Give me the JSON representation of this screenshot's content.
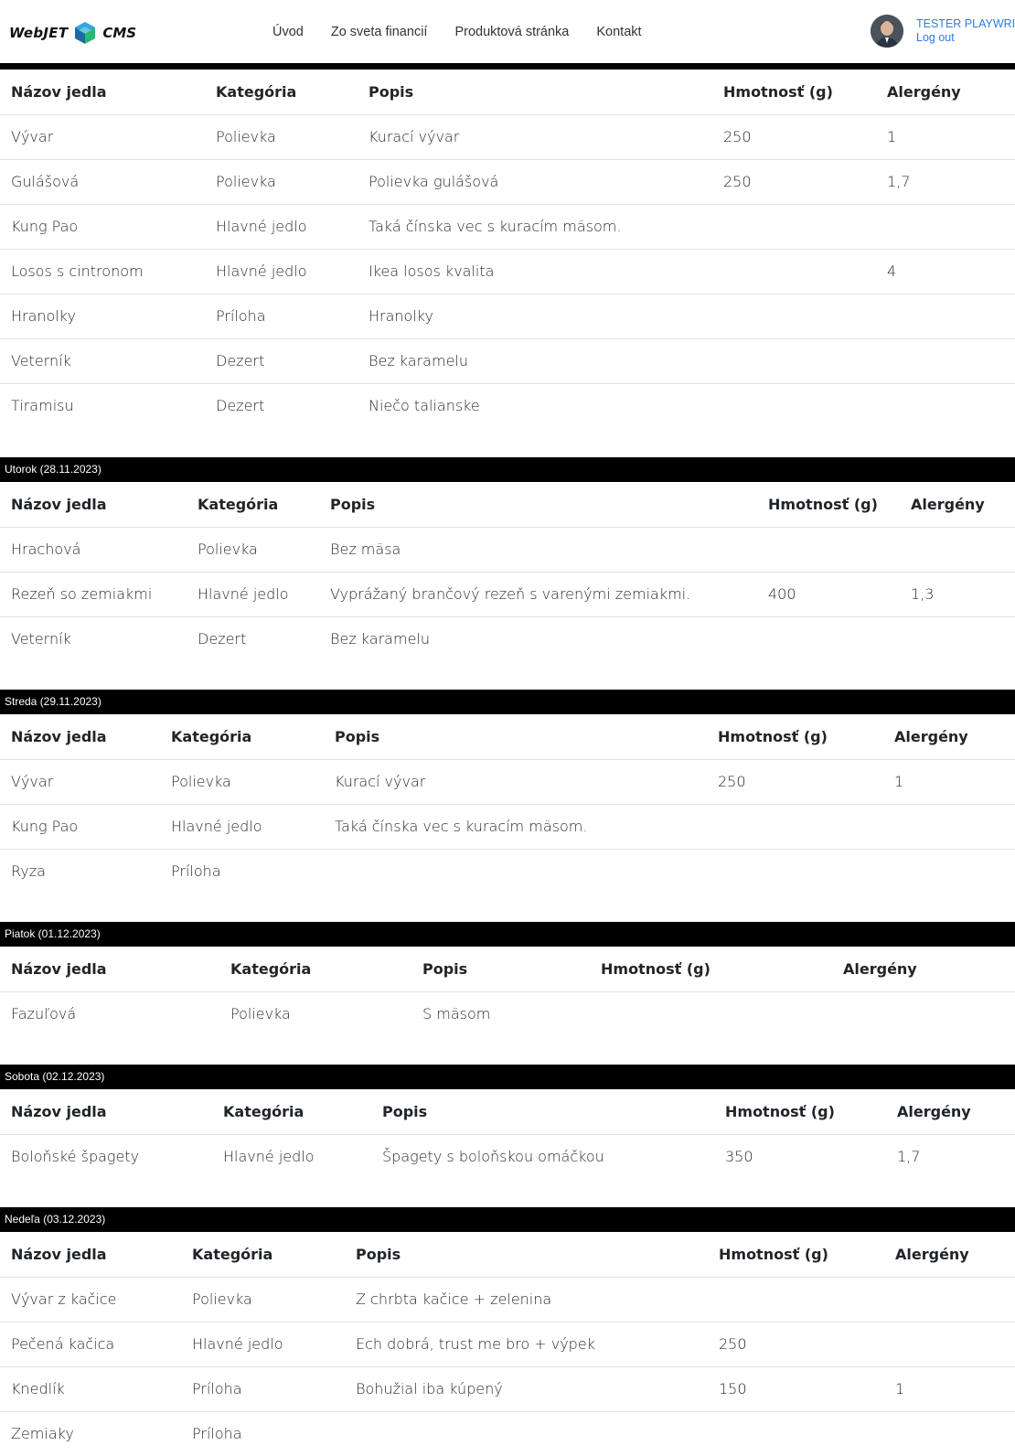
{
  "header": {
    "logo_text_left": "WebJET",
    "logo_text_right": "CMS",
    "nav": [
      "Úvod",
      "Zo sveta financií",
      "Produktová stránka",
      "Kontakt"
    ],
    "user_name": "TESTER PLAYWRIGHT",
    "logout_label": "Log out"
  },
  "columns": [
    "Názov jedla",
    "Kategória",
    "Popis",
    "Hmotnosť (g)",
    "Alergény"
  ],
  "days": [
    {
      "label": "",
      "rows": [
        [
          "Vývar",
          "Polievka",
          "Kurací vývar",
          "250",
          "1"
        ],
        [
          "Gulášová",
          "Polievka",
          "Polievka gulášová",
          "250",
          "1,7"
        ],
        [
          "Kung Pao",
          "Hlavné jedlo",
          "Taká čínska vec s kuracím mäsom.",
          "",
          ""
        ],
        [
          "Losos s cintronom",
          "Hlavné jedlo",
          "Ikea losos kvalita",
          "",
          "4"
        ],
        [
          "Hranolky",
          "Príloha",
          "Hranolky",
          "",
          ""
        ],
        [
          "Veterník",
          "Dezert",
          "Bez karamelu",
          "",
          ""
        ],
        [
          "Tiramisu",
          "Dezert",
          "Niečo talianske",
          "",
          ""
        ]
      ]
    },
    {
      "label": "Utorok (28.11.2023)",
      "rows": [
        [
          "Hrachová",
          "Polievka",
          "Bez mäsa",
          "",
          ""
        ],
        [
          "Rezeň so zemiakmi",
          "Hlavné jedlo",
          "Vyprážaný brančový rezeň s varenými zemiakmi.",
          "400",
          "1,3"
        ],
        [
          "Veterník",
          "Dezert",
          "Bez karamelu",
          "",
          ""
        ]
      ]
    },
    {
      "label": "Streda (29.11.2023)",
      "rows": [
        [
          "Vývar",
          "Polievka",
          "Kurací vývar",
          "250",
          "1"
        ],
        [
          "Kung Pao",
          "Hlavné jedlo",
          "Taká čínska vec s kuracím mäsom.",
          "",
          ""
        ],
        [
          "Ryza",
          "Príloha",
          "",
          "",
          ""
        ]
      ]
    },
    {
      "label": "Piatok (01.12.2023)",
      "rows": [
        [
          "Fazuľová",
          "Polievka",
          "S mäsom",
          "",
          ""
        ]
      ]
    },
    {
      "label": "Sobota (02.12.2023)",
      "rows": [
        [
          "Boloňské špagety",
          "Hlavné jedlo",
          "Špagety s boloňskou omáčkou",
          "350",
          "1,7"
        ]
      ]
    },
    {
      "label": "Nedeľa (03.12.2023)",
      "rows": [
        [
          "Vývar z kačice",
          "Polievka",
          "Z chrbta kačice + zelenina",
          "",
          ""
        ],
        [
          "Pečená kačica",
          "Hlavné jedlo",
          "Ech dobrá, trust me bro + výpek",
          "250",
          ""
        ],
        [
          "Knedlík",
          "Príloha",
          "Bohužial iba kúpený",
          "150",
          "1"
        ],
        [
          "Zemiaky",
          "Príloha",
          "",
          "",
          ""
        ]
      ]
    }
  ]
}
